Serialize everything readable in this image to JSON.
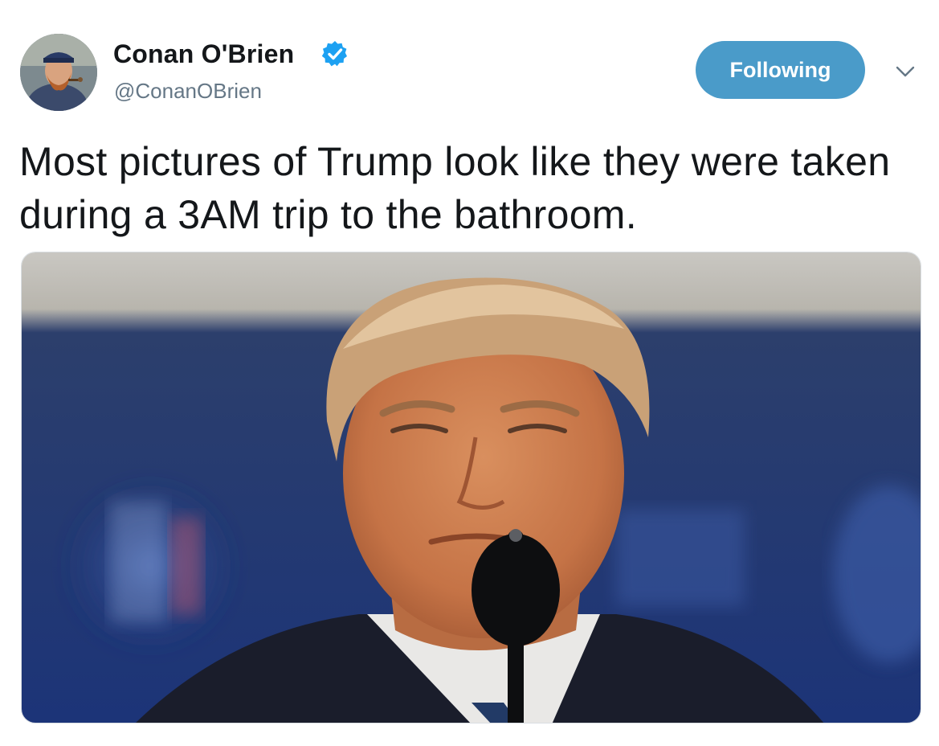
{
  "tweet": {
    "author": {
      "display_name": "Conan O'Brien",
      "handle": "@ConanOBrien",
      "verified": true,
      "avatar_icon": "user-avatar"
    },
    "follow_button": {
      "label": "Following",
      "color": "#4a9bc9"
    },
    "menu_icon": "chevron-down-icon",
    "text": "Most pictures of Trump look like they were taken during a 3AM trip to the bathroom.",
    "media": {
      "kind": "photo",
      "icon": "photo-portrait-with-microphone"
    }
  },
  "colors": {
    "verified_badge": "#1da1f2",
    "text_primary": "#14171a",
    "text_secondary": "#657786",
    "photo_background": "#1f3b78"
  }
}
